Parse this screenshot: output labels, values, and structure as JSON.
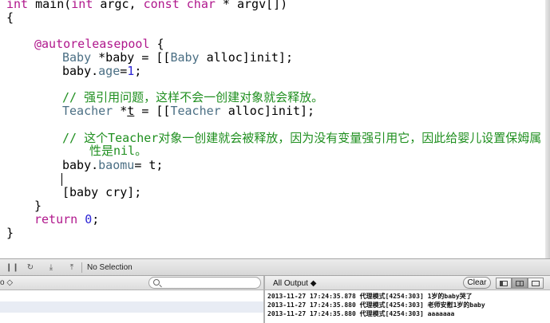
{
  "editor": {
    "lines": [
      {
        "kind": "main",
        "t1": "int",
        "t2": " main(",
        "t3": "int",
        "t4": " argc, ",
        "t5": "const",
        "t6": " ",
        "t7": "char",
        "t8": " * argv[])"
      },
      {
        "kind": "plain",
        "text": "{"
      },
      {
        "kind": "pool",
        "text": "@autoreleasepool",
        "rest": " {"
      },
      {
        "kind": "alloc",
        "cls1": "Baby",
        "mid": " *baby = [[",
        "cls2": "Baby",
        "end": " alloc]init];"
      },
      {
        "kind": "assign",
        "pre": "baby.",
        "prop": "age",
        "eq": "=",
        "num": "1",
        "end": ";"
      },
      {
        "kind": "comment",
        "text": "// 强引用问题，这样不会一创建对象就会释放。"
      },
      {
        "kind": "alloc2",
        "cls1": "Teacher",
        "mid": " *",
        "var": "t",
        "mid2": " = [[",
        "cls2": "Teacher",
        "end": " alloc]init];"
      },
      {
        "kind": "comment",
        "text": "// 这个Teacher对象一创建就会被释放，因为没有变量强引用它，因此给婴儿设置保姆属"
      },
      {
        "kind": "comment-wrap",
        "text": "性是nil。"
      },
      {
        "kind": "assign2",
        "pre": "baby.",
        "prop": "baomu",
        "end": "= t;"
      },
      {
        "kind": "plain",
        "text": "[baby cry];"
      },
      {
        "kind": "plain",
        "text": "}"
      },
      {
        "kind": "return",
        "kw": "return",
        "sp": " ",
        "num": "0",
        "end": ";"
      },
      {
        "kind": "plain",
        "text": "}"
      }
    ]
  },
  "debug_bar": {
    "buttons": [
      {
        "name": "pause",
        "glyph": "❙❙"
      },
      {
        "name": "continue",
        "glyph": "↻"
      },
      {
        "name": "step-over",
        "glyph": "⤓"
      },
      {
        "name": "step-into",
        "glyph": "⤒"
      }
    ],
    "selection_text": "No Selection"
  },
  "lower_header": {
    "scope_label": "o ◇",
    "output_label": "All Output ◆",
    "clear_label": "Clear"
  },
  "console": {
    "lines": [
      "2013-11-27 17:24:35.878 代理模式[4254:303] 1岁的baby哭了",
      "2013-11-27 17:24:35.880 代理模式[4254:303] 老师安慰1岁的baby",
      "2013-11-27 17:24:35.880 代理模式[4254:303] aaaaaaa"
    ]
  }
}
